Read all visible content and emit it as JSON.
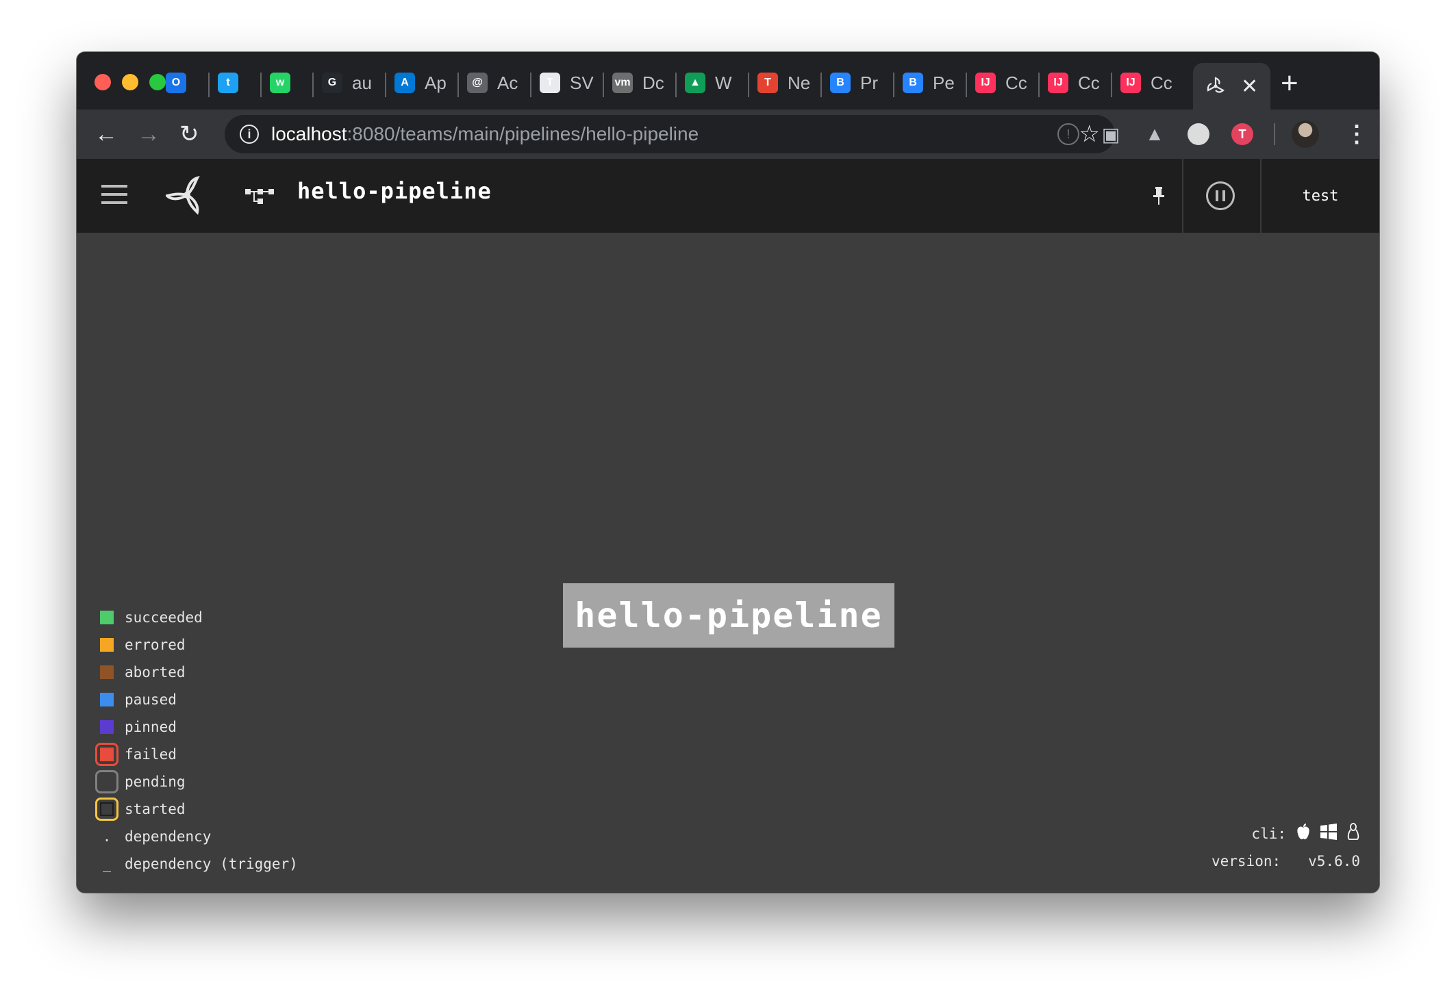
{
  "browser": {
    "tabs": [
      {
        "label": "",
        "icon": "circle-app-icon",
        "color": "#1a73e8"
      },
      {
        "label": "",
        "icon": "twitter-icon",
        "color": "#1da1f2"
      },
      {
        "label": "",
        "icon": "whatsapp-icon",
        "color": "#25d366"
      },
      {
        "label": "au",
        "icon": "github-icon",
        "color": "#24292e"
      },
      {
        "label": "Ap",
        "icon": "azure-devops-icon",
        "color": "#0078d4"
      },
      {
        "label": "Ac",
        "icon": "globe-icon",
        "color": "#5f6368"
      },
      {
        "label": "SV",
        "icon": "trello-icon",
        "color": "#e8eaed"
      },
      {
        "label": "Dc",
        "icon": "vmware-icon",
        "color": "#6d6e70"
      },
      {
        "label": "W",
        "icon": "google-drive-icon",
        "color": "#0f9d58"
      },
      {
        "label": "Ne",
        "icon": "todoist-icon",
        "color": "#e44332"
      },
      {
        "label": "Pr",
        "icon": "bitbucket-icon",
        "color": "#2684ff"
      },
      {
        "label": "Pe",
        "icon": "bitbucket-icon",
        "color": "#2684ff"
      },
      {
        "label": "Cc",
        "icon": "intellij-icon",
        "color": "#fe315d"
      },
      {
        "label": "Cc",
        "icon": "intellij-icon",
        "color": "#fe315d"
      },
      {
        "label": "Cc",
        "icon": "intellij-icon",
        "color": "#fe315d"
      }
    ],
    "active_tab": {
      "icon": "concourse-icon",
      "close": "✕"
    },
    "new_tab": "+",
    "url_host": "localhost",
    "url_path": ":8080/teams/main/pipelines/hello-pipeline"
  },
  "header": {
    "pipeline_name": "hello-pipeline",
    "user": "test"
  },
  "canvas": {
    "job_name": "hello-pipeline"
  },
  "legend": [
    {
      "label": "succeeded",
      "type": "solid",
      "color": "#4ecb6a"
    },
    {
      "label": "errored",
      "type": "solid",
      "color": "#f5a623"
    },
    {
      "label": "aborted",
      "type": "solid",
      "color": "#8f5327"
    },
    {
      "label": "paused",
      "type": "solid",
      "color": "#3d8df0"
    },
    {
      "label": "pinned",
      "type": "solid",
      "color": "#5c3bd1"
    },
    {
      "label": "failed",
      "type": "outlined",
      "color": "#e74c3c",
      "fill": "#e74c3c"
    },
    {
      "label": "pending",
      "type": "outlined",
      "color": "#808080",
      "fill": "#3d3d3d"
    },
    {
      "label": "started",
      "type": "outlined",
      "color": "#f5c542",
      "fill": "#3d3d3d"
    },
    {
      "label": "dependency",
      "type": "mark",
      "mark": "."
    },
    {
      "label": "dependency (trigger)",
      "type": "mark",
      "mark": "_"
    }
  ],
  "footer": {
    "cli_label": "cli:",
    "version_label": "version:",
    "version_value": "v5.6.0"
  }
}
